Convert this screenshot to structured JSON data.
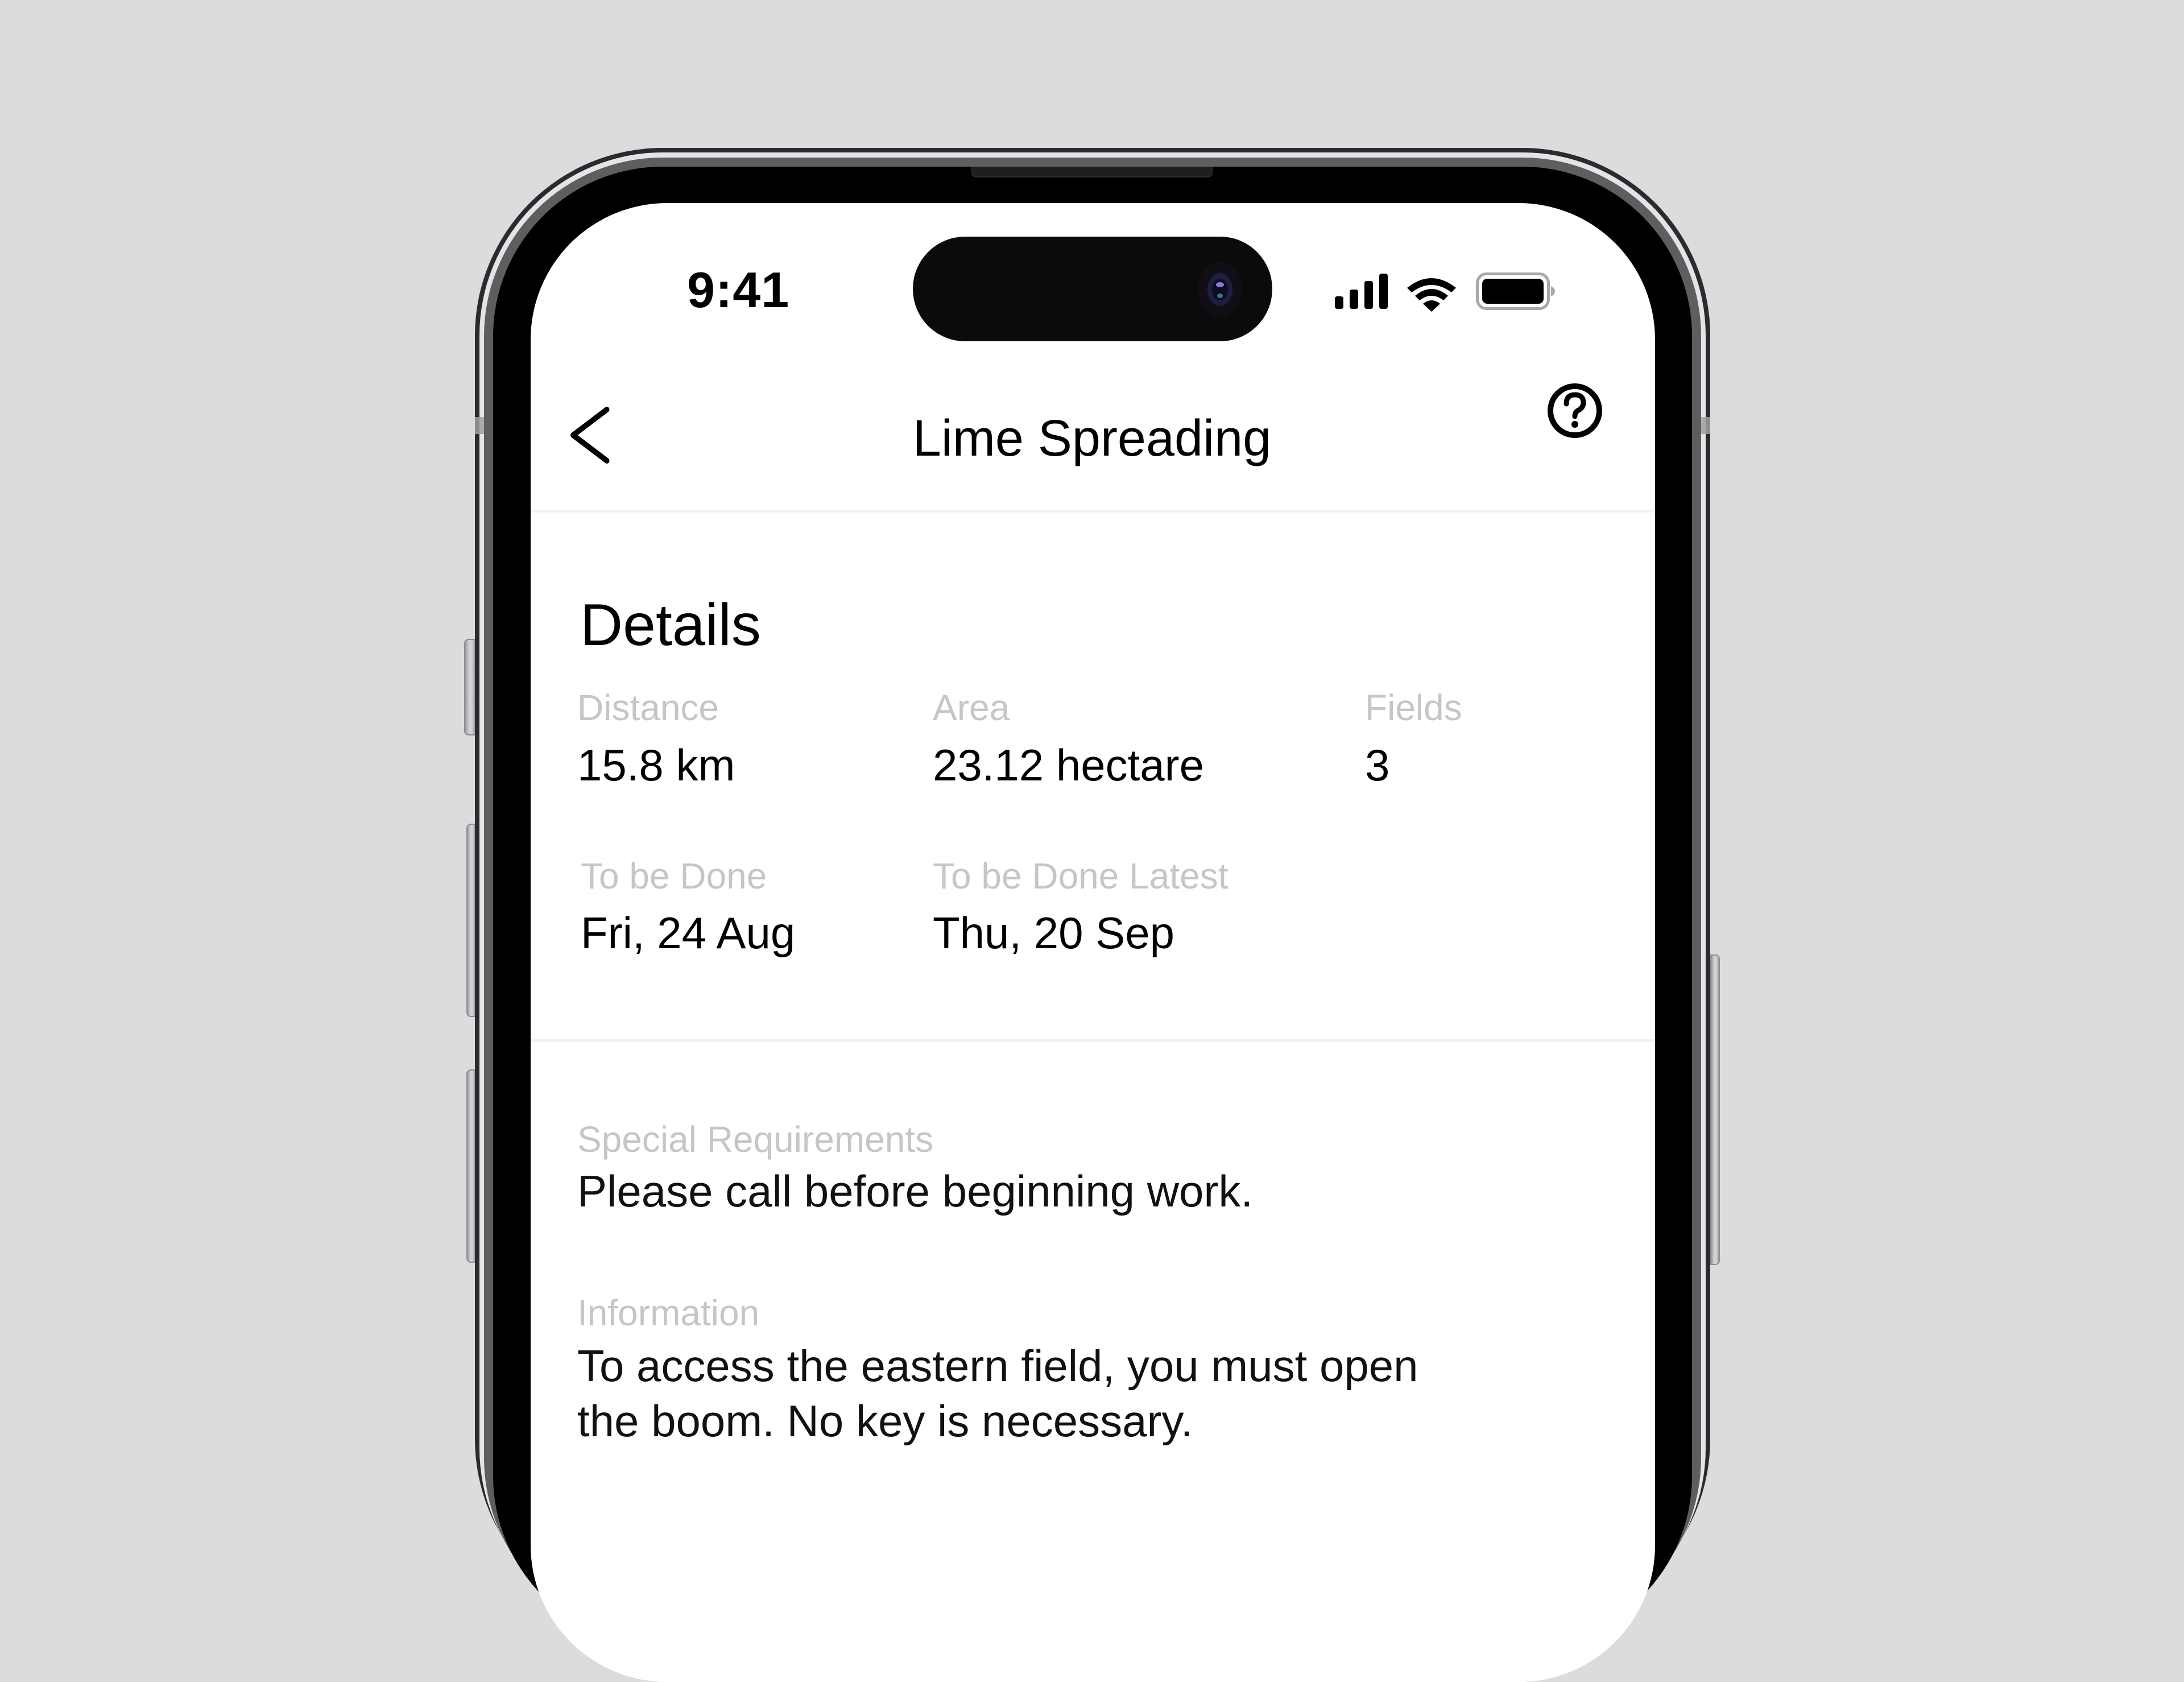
{
  "status_bar": {
    "time": "9:41",
    "icons": [
      "cellular-signal-icon",
      "wifi-icon",
      "battery-icon"
    ]
  },
  "nav": {
    "back_icon": "chevron-left-icon",
    "title": "Lime Spreading",
    "help_icon": "question-circle-icon"
  },
  "details": {
    "heading": "Details",
    "rows": [
      [
        {
          "label": "Distance",
          "value": "15.8 km"
        },
        {
          "label": "Area",
          "value": "23.12 hectare"
        },
        {
          "label": "Fields",
          "value": "3"
        }
      ],
      [
        {
          "label": "To be Done",
          "value": "Fri, 24 Aug"
        },
        {
          "label": "To be Done Latest",
          "value": "Thu, 20 Sep"
        }
      ]
    ]
  },
  "notes": {
    "special_requirements": {
      "label": "Special Requirements",
      "value": "Please call before beginning work."
    },
    "information": {
      "label": "Information",
      "lines": [
        "To access the eastern field, you must open",
        "the boom. No key is necessary."
      ]
    }
  },
  "colors": {
    "background": "#dcdcdc",
    "label": "#c6c6c8",
    "text": "#000000",
    "divider": "#f2f2f2"
  }
}
